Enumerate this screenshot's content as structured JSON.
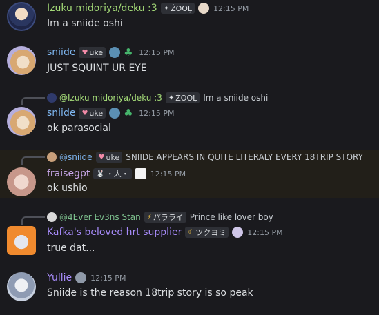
{
  "messages": [
    {
      "user": "Izuku midoriya/deku :3",
      "tag": "ŻOOĻ",
      "timestamp": "12:15 PM",
      "text": "Im a sniide oshi",
      "name_color": "#a3d977",
      "avatar_color": "#2f3a6b"
    },
    {
      "user": "sniide",
      "tag": "uke",
      "timestamp": "12:15 PM",
      "text": "JUST SQUINT UR EYE",
      "name_color": "#7eb6f0",
      "avatar_color": "#c9a07a"
    },
    {
      "reply": {
        "user": "@Izuku midoriya/deku :3",
        "tag": "ŻOOĻ",
        "text": "Im a sniide oshi"
      },
      "user": "sniide",
      "tag": "uke",
      "timestamp": "12:15 PM",
      "text": "ok parasocial",
      "name_color": "#7eb6f0",
      "avatar_color": "#c9a07a"
    },
    {
      "reply": {
        "user": "@sniide",
        "tag": "uke",
        "text": "SNIIDE APPEARS IN QUITE LITERALY EVERY 18TRIP STORY"
      },
      "user": "fraisegpt",
      "tag": "・人・",
      "timestamp": "12:15 PM",
      "text": "ok ushio",
      "name_color": "#c7a6e8",
      "avatar_color": "#d7b2a6"
    },
    {
      "reply": {
        "user": "@4Ever Ev3ns Stan",
        "tag": "パラライ",
        "text": "Prince like lover boy"
      },
      "user": "Kafka's beloved hrt supplier",
      "tag": "ツクヨミ",
      "timestamp": "12:15 PM",
      "text": "true dat...",
      "name_color": "#a78bfa",
      "avatar_color": "#ee8a2f"
    },
    {
      "user": "Yullie",
      "timestamp": "12:15 PM",
      "text": "Sniide is the reason 18trip story is so peak",
      "name_color": "#a78bfa",
      "avatar_color": "#b9c4d8"
    }
  ]
}
